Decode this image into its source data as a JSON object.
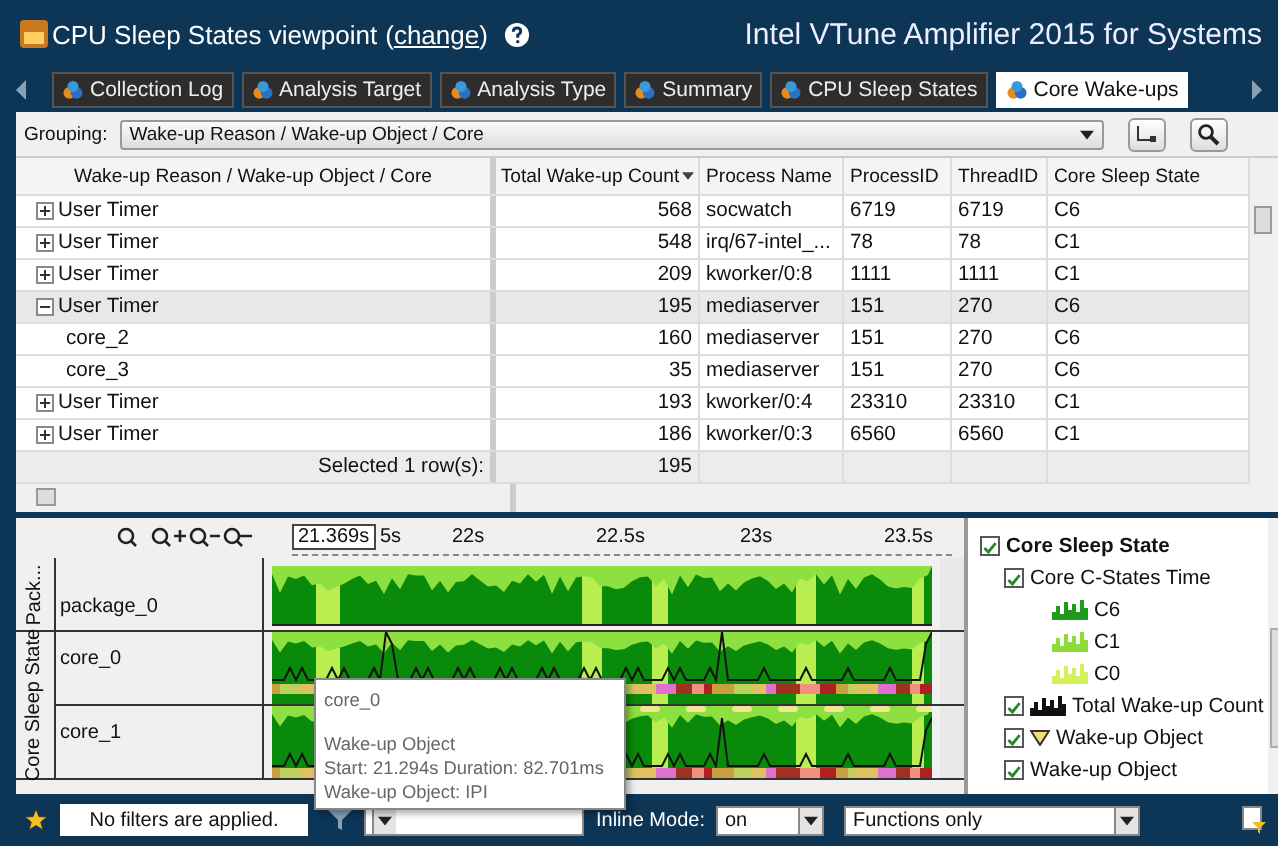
{
  "title": "CPU Sleep States viewpoint",
  "paren_open": "(",
  "change_link": "change",
  "paren_close": ")",
  "product": "Intel VTune Amplifier 2015 for Systems",
  "tabs": [
    {
      "label": "Collection Log",
      "selected": false
    },
    {
      "label": "Analysis Target",
      "selected": false
    },
    {
      "label": "Analysis Type",
      "selected": false
    },
    {
      "label": "Summary",
      "selected": false
    },
    {
      "label": "CPU Sleep States",
      "selected": false
    },
    {
      "label": "Core Wake-ups",
      "selected": true
    }
  ],
  "grouping": {
    "label": "Grouping:",
    "value": "Wake-up Reason / Wake-up Object / Core"
  },
  "table": {
    "columns": [
      {
        "label": "Wake-up Reason / Wake-up Object / Core",
        "sorted": false
      },
      {
        "label": "Total Wake-up Count",
        "sorted": true
      },
      {
        "label": "Process Name",
        "sorted": false
      },
      {
        "label": "ProcessID",
        "sorted": false
      },
      {
        "label": "ThreadID",
        "sorted": false
      },
      {
        "label": "Core Sleep State",
        "sorted": false
      }
    ],
    "rows": [
      {
        "expanded": false,
        "selected": false,
        "cells": [
          "User Timer",
          "568",
          "socwatch",
          "6719",
          "6719",
          "C6"
        ]
      },
      {
        "expanded": false,
        "selected": false,
        "cells": [
          "User Timer",
          "548",
          "irq/67-intel_...",
          "78",
          "78",
          "C1"
        ]
      },
      {
        "expanded": false,
        "selected": false,
        "cells": [
          "User Timer",
          "209",
          "kworker/0:8",
          "1111",
          "1111",
          "C1"
        ]
      },
      {
        "expanded": true,
        "selected": true,
        "cells": [
          "User Timer",
          "195",
          "mediaserver",
          "151",
          "270",
          "C6"
        ],
        "children": [
          {
            "cells": [
              "core_2",
              "160",
              "mediaserver",
              "151",
              "270",
              "C6"
            ]
          },
          {
            "cells": [
              "core_3",
              "35",
              "mediaserver",
              "151",
              "270",
              "C6"
            ]
          }
        ]
      },
      {
        "expanded": false,
        "selected": false,
        "cells": [
          "User Timer",
          "193",
          "kworker/0:4",
          "23310",
          "23310",
          "C1"
        ]
      },
      {
        "expanded": false,
        "selected": false,
        "cells": [
          "User Timer",
          "186",
          "kworker/0:3",
          "6560",
          "6560",
          "C1"
        ]
      }
    ],
    "summary": {
      "label": "Selected 1 row(s):",
      "value": "195"
    }
  },
  "timeline": {
    "cursor_time": "21.369s",
    "ticks": [
      "5s",
      "22s",
      "22.5s",
      "23s",
      "23.5s"
    ],
    "groups": [
      {
        "label": "Pack...",
        "lanes": [
          {
            "name": "package_0",
            "kind": "package"
          }
        ]
      },
      {
        "label": "Core Sleep State",
        "lanes": [
          {
            "name": "core_0",
            "kind": "core"
          },
          {
            "name": "core_1",
            "kind": "core"
          }
        ]
      }
    ],
    "tooltip": {
      "title": "core_0",
      "lines": [
        "Wake-up Object",
        "Start: 21.294s Duration: 82.701ms",
        "Wake-up Object: IPI"
      ]
    }
  },
  "legend": [
    {
      "label": "Core Sleep State",
      "checked": true,
      "children": [
        {
          "label": "Core C-States Time",
          "kind": "checkbox",
          "checked": true,
          "children": [
            {
              "label": "C6",
              "color": "#1e9a1e"
            },
            {
              "label": "C1",
              "color": "#8edc3a"
            },
            {
              "label": "C0",
              "color": "#d4f05a"
            }
          ]
        },
        {
          "label": "Total Wake-up Count",
          "kind": "count",
          "checked": true
        },
        {
          "label": "Wake-up Object",
          "kind": "marker",
          "checked": true
        },
        {
          "label": "Wake-up Object",
          "kind": "checkbox",
          "checked": true
        }
      ]
    }
  ],
  "bottom": {
    "filter": "No filters are applied.",
    "inline_label": "Inline Mode:",
    "inline_value": "on",
    "functions_value": "Functions only"
  }
}
